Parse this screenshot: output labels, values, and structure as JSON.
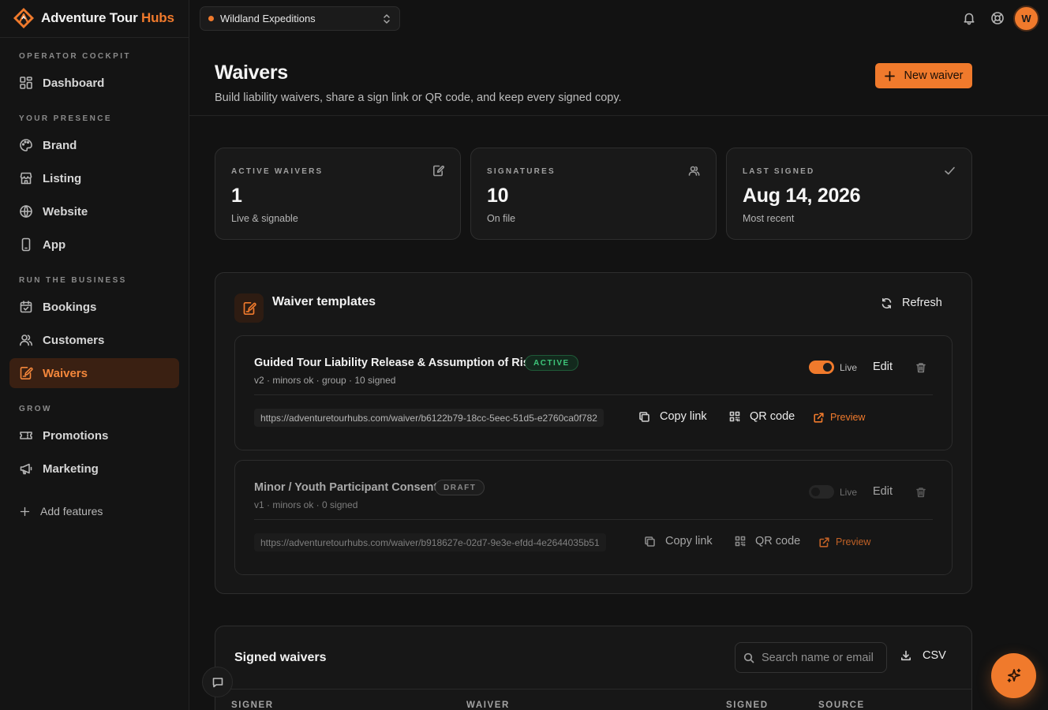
{
  "app": {
    "brand_name": "Adventure Tour",
    "brand_accent": "Hubs",
    "accent_color": "#f07a2c",
    "logo_icon": "compass-diamond-logo"
  },
  "topbar": {
    "org_name": "Wildland Expeditions",
    "org_status_color": "#f07a2c",
    "icons": [
      "bell-icon",
      "help-lifebuoy-icon"
    ],
    "avatar_initial": "W"
  },
  "sidebar": {
    "sections": [
      {
        "label": "OPERATOR COCKPIT",
        "items": [
          {
            "label": "Dashboard",
            "icon": "dashboard-icon"
          }
        ]
      },
      {
        "label": "YOUR PRESENCE",
        "items": [
          {
            "label": "Brand",
            "icon": "palette-icon"
          },
          {
            "label": "Listing",
            "icon": "store-icon"
          },
          {
            "label": "Website",
            "icon": "globe-icon"
          },
          {
            "label": "App",
            "icon": "phone-icon"
          }
        ]
      },
      {
        "label": "RUN THE BUSINESS",
        "items": [
          {
            "label": "Bookings",
            "icon": "calendar-check-icon"
          },
          {
            "label": "Customers",
            "icon": "users-icon"
          },
          {
            "label": "Waivers",
            "icon": "file-signature-icon",
            "active": true
          }
        ]
      },
      {
        "label": "GROW",
        "items": [
          {
            "label": "Promotions",
            "icon": "ticket-icon"
          },
          {
            "label": "Marketing",
            "icon": "megaphone-icon"
          }
        ]
      }
    ],
    "add_features": "Add features"
  },
  "page": {
    "title": "Waivers",
    "subtitle": "Build liability waivers, share a sign link or QR code, and keep every signed copy.",
    "new_button": "New waiver"
  },
  "stats": [
    {
      "label": "ACTIVE WAIVERS",
      "value": "1",
      "note": "Live & signable",
      "icon": "file-edit-icon"
    },
    {
      "label": "SIGNATURES",
      "value": "10",
      "note": "On file",
      "icon": "users-icon"
    },
    {
      "label": "LAST SIGNED",
      "value": "Aug 14, 2026",
      "note": "Most recent",
      "icon": "check-icon"
    }
  ],
  "templates_panel": {
    "title": "Waiver templates",
    "refresh_label": "Refresh",
    "templates": [
      {
        "name": "Guided Tour Liability Release & Assumption of Risk",
        "status": "ACTIVE",
        "meta": "v2 · minors ok · group · 10 signed",
        "live": true,
        "live_label": "Live",
        "edit_label": "Edit",
        "url": "https://adventuretourhubs.com/waiver/b6122b79-18cc-5eec-51d5-e2760ca0f782",
        "copy_label": "Copy link",
        "qr_label": "QR code",
        "preview_label": "Preview"
      },
      {
        "name": "Minor / Youth Participant Consent",
        "status": "DRAFT",
        "meta": "v1 · minors ok · 0 signed",
        "live": false,
        "live_label": "Live",
        "edit_label": "Edit",
        "url": "https://adventuretourhubs.com/waiver/b918627e-02d7-9e3e-efdd-4e2644035b51",
        "copy_label": "Copy link",
        "qr_label": "QR code",
        "preview_label": "Preview"
      }
    ]
  },
  "signed_panel": {
    "title": "Signed waivers",
    "search_placeholder": "Search name or email",
    "csv_label": "CSV",
    "columns": [
      "SIGNER",
      "WAIVER",
      "SIGNED",
      "SOURCE"
    ]
  }
}
